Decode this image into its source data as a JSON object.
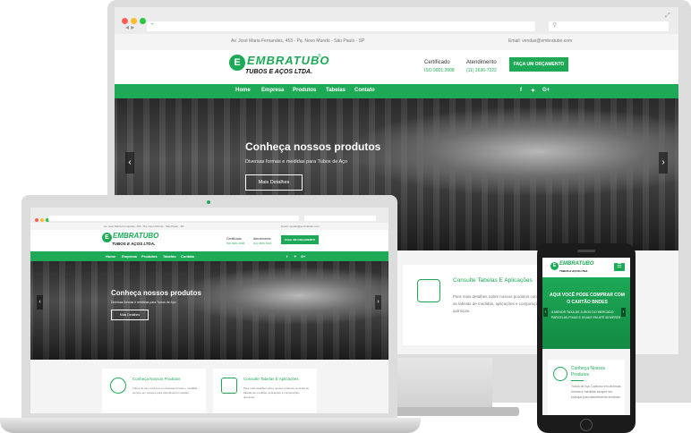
{
  "topbar": {
    "address": "Av. José Maria Fernandes, 453 - Pq. Novo Mundo - São Paulo - SP",
    "email": "Email: vendas@embratubo.com"
  },
  "brand": {
    "badge": "E",
    "name": "EMBRATUBO",
    "tagline": "TUBOS E AÇOS LTDA.",
    "reg": "®"
  },
  "header": {
    "cert_label": "Certificado",
    "cert_value": "ISO 9001:2008",
    "service_label": "Atendimento",
    "service_value": "(11) 2636-7222",
    "cta": "FAÇA UM ORÇAMENTO"
  },
  "nav": {
    "items": [
      "Home",
      "Empresa",
      "Produtos",
      "Tabelas",
      "Contato"
    ],
    "social": [
      "f",
      "✦",
      "G+"
    ]
  },
  "hero": {
    "title": "Conheça nossos produtos",
    "subtitle": "Diversas formas e medidas para Tubos de Aço",
    "button": "Mais Detalhes",
    "prev": "‹",
    "next": "›"
  },
  "cards": {
    "products_title": "Conheça Nossos Produtos",
    "products_text": "Tubos de Aço Carbono em diversas formas e medidas sempre em estoque para atendimento imediato.",
    "tables_title": "Consulte Tabelas E Aplicações",
    "tables_text": "Para mais detalhes sobre nossos produtos consulte as tabelas de medidas, aplicações e composições químicas."
  },
  "mobile": {
    "promo_title": "AQUI VOCÊ PODE COMPRAR COM O CARTÃO BNDES",
    "promo_text": "A MENOR TAXA DE JUROS DO MERCADO PARCELAS FIXAS E IGUAIS EM ATÉ 48 MESES",
    "card_title": "Conheça Nossos Produtos",
    "card_text": "Tubos de Aço Carbono em diversas formas e medidas sempre em estoque para atendimento imediato."
  },
  "colors": {
    "accent": "#1da956",
    "dark": "#222222",
    "light_bg": "#f4f4f4"
  }
}
